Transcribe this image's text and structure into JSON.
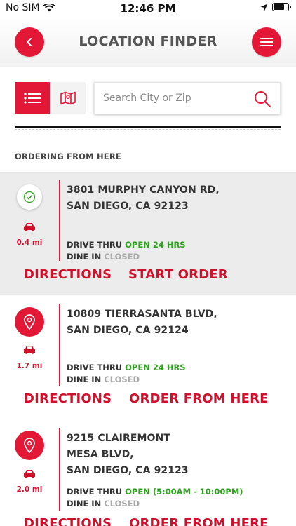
{
  "status_bar": {
    "carrier": "No SIM",
    "time": "12:46 PM",
    "battery_level": 0.75
  },
  "header": {
    "title": "LOCATION FINDER",
    "back_icon": "chevron-left-icon",
    "menu_icon": "hamburger-menu-icon"
  },
  "search": {
    "placeholder": "Search City or Zip",
    "value": "",
    "list_view_icon": "list-icon",
    "map_view_icon": "map-icon"
  },
  "section": {
    "title": "ORDERING FROM HERE"
  },
  "labels": {
    "drive_thru": "DRIVE THRU",
    "dine_in": "DINE IN",
    "directions": "DIRECTIONS"
  },
  "locations": [
    {
      "selected": true,
      "address_line1": "3801 MURPHY CANYON RD,",
      "address_line2": "SAN DIEGO, CA 92123",
      "distance": "0.4 mi",
      "drive_thru_status": "OPEN 24 HRS",
      "dine_in_status": "CLOSED",
      "action_label": "START ORDER"
    },
    {
      "selected": false,
      "address_line1": "10809 TIERRASANTA BLVD,",
      "address_line2": "SAN DIEGO, CA 92124",
      "distance": "1.7 mi",
      "drive_thru_status": "OPEN 24 HRS",
      "dine_in_status": "CLOSED",
      "action_label": "ORDER FROM HERE"
    },
    {
      "selected": false,
      "address_line1": "9215 CLAIREMONT",
      "address_line2": "MESA BLVD,",
      "address_line3": "SAN DIEGO, CA 92123",
      "distance": "2.0 mi",
      "drive_thru_status": "OPEN (5:00AM - 10:00PM)",
      "dine_in_status": "CLOSED",
      "action_label": "ORDER FROM HERE"
    }
  ],
  "colors": {
    "brand_red": "#e31837",
    "open_green": "#2ea31e",
    "closed_gray": "#a8a8a8"
  }
}
